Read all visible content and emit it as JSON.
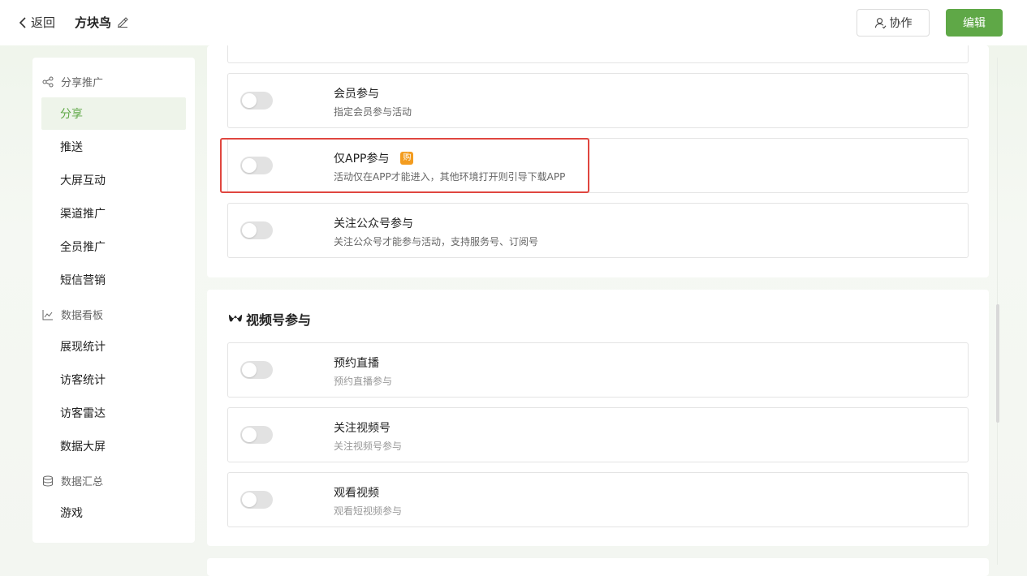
{
  "topbar": {
    "back_label": "返回",
    "title": "方块鸟",
    "collab_label": "协作",
    "edit_label": "编辑"
  },
  "sidebar": {
    "groups": [
      {
        "label": "分享推广",
        "icon": "share-icon"
      },
      {
        "label": "数据看板",
        "icon": "chart-line-icon"
      },
      {
        "label": "数据汇总",
        "icon": "database-icon"
      }
    ],
    "items": [
      {
        "label": "分享",
        "active": true
      },
      {
        "label": "推送"
      },
      {
        "label": "大屏互动"
      },
      {
        "label": "渠道推广"
      },
      {
        "label": "全员推广"
      },
      {
        "label": "短信营销"
      },
      {
        "label": "展现统计"
      },
      {
        "label": "访客统计"
      },
      {
        "label": "访客雷达"
      },
      {
        "label": "数据大屏"
      },
      {
        "label": "游戏"
      }
    ]
  },
  "settings": [
    {
      "title": "会员参与",
      "desc": "指定会员参与活动",
      "enabled": false
    },
    {
      "title": "仅APP参与",
      "badge": "购",
      "desc": "活动仅在APP才能进入，其他环境打开则引导下载APP",
      "enabled": false
    },
    {
      "title": "关注公众号参与",
      "desc": "关注公众号才能参与活动，支持服务号、订阅号",
      "enabled": false
    }
  ],
  "video_section": {
    "title": "视频号参与",
    "items": [
      {
        "title": "预约直播",
        "desc": "预约直播参与",
        "enabled": false
      },
      {
        "title": "关注视频号",
        "desc": "关注视频号参与",
        "enabled": false
      },
      {
        "title": "观看视频",
        "desc": "观看短视频参与",
        "enabled": false
      }
    ]
  },
  "colors": {
    "accent": "#5fa847",
    "highlight": "#e0463f",
    "badge": "#f39c1f"
  }
}
